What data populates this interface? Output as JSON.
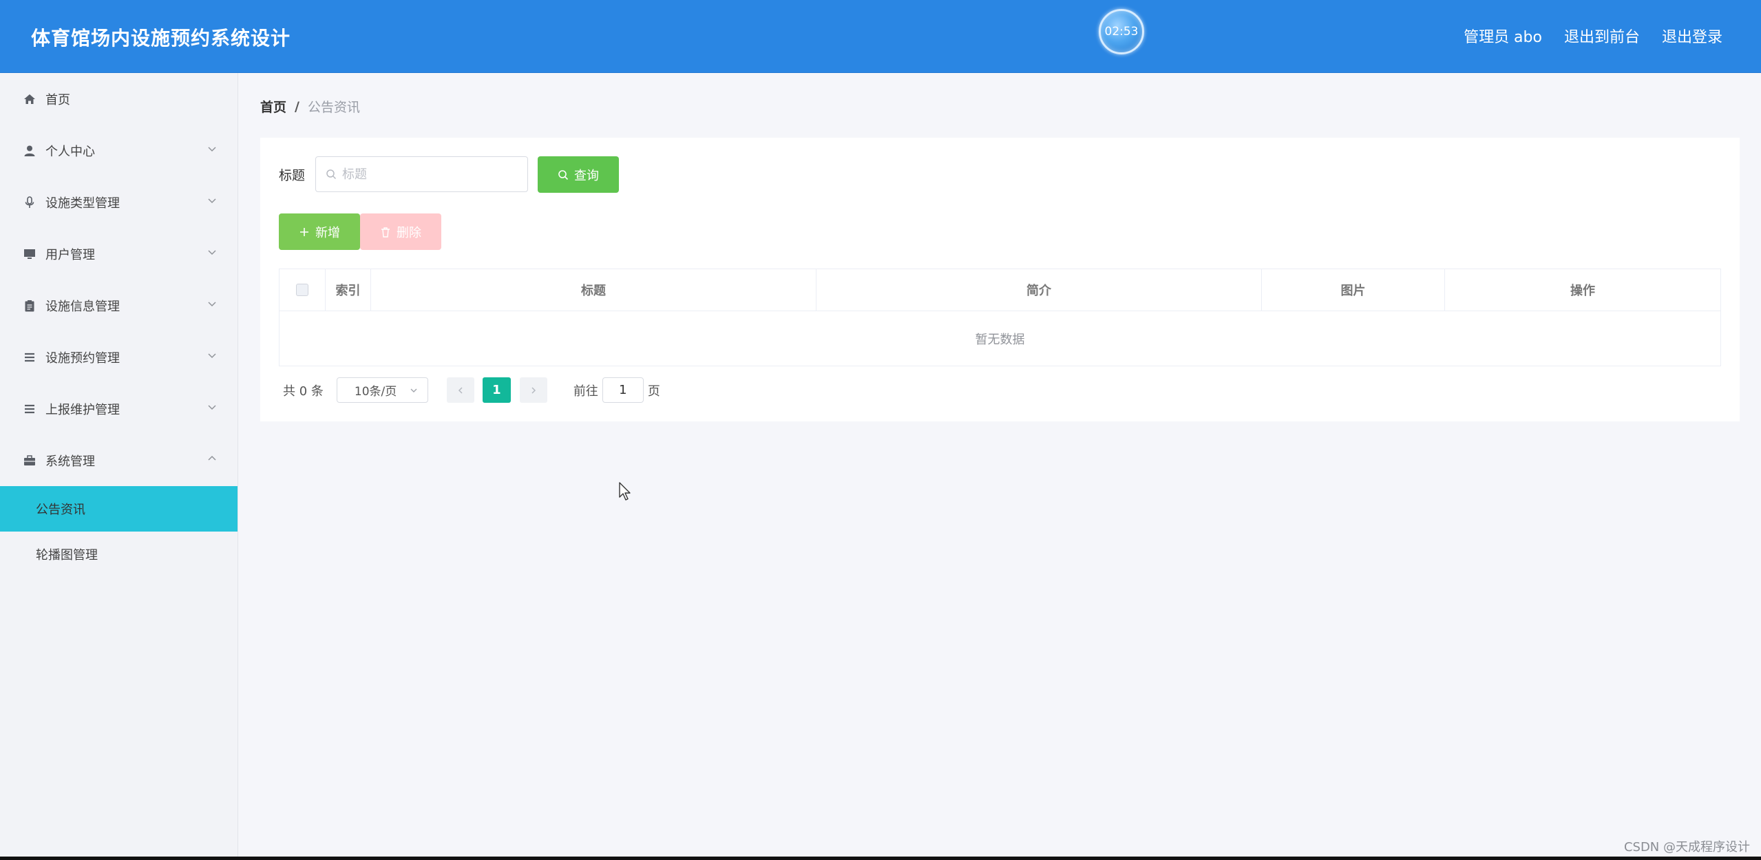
{
  "header": {
    "title": "体育馆场内设施预约系统设计",
    "clock": "02:53",
    "user": "管理员 abo",
    "to_frontend": "退出到前台",
    "logout": "退出登录"
  },
  "sidebar": {
    "items": [
      {
        "label": "首页",
        "icon": "home-icon"
      },
      {
        "label": "个人中心",
        "icon": "user-icon"
      },
      {
        "label": "设施类型管理",
        "icon": "microphone-icon"
      },
      {
        "label": "用户管理",
        "icon": "monitor-icon"
      },
      {
        "label": "设施信息管理",
        "icon": "clipboard-icon"
      },
      {
        "label": "设施预约管理",
        "icon": "list-icon"
      },
      {
        "label": "上报维护管理",
        "icon": "list-icon"
      },
      {
        "label": "系统管理",
        "icon": "briefcase-icon"
      }
    ],
    "subitems": [
      {
        "label": "公告资讯",
        "active": true
      },
      {
        "label": "轮播图管理",
        "active": false
      }
    ]
  },
  "breadcrumb": {
    "home": "首页",
    "separator": "/",
    "current": "公告资讯"
  },
  "search": {
    "label": "标题",
    "placeholder": "标题",
    "button": "查询"
  },
  "actions": {
    "add": "新增",
    "delete": "删除"
  },
  "table": {
    "columns": [
      "索引",
      "标题",
      "简介",
      "图片",
      "操作"
    ],
    "empty_text": "暂无数据"
  },
  "pagination": {
    "total": "共 0 条",
    "page_size": "10条/页",
    "current_page": "1",
    "goto_label": "前往",
    "goto_value": "1",
    "page_suffix": "页"
  },
  "watermark": "CSDN @天成程序设计",
  "colors": {
    "header_bg": "#2a86e3",
    "active_menu": "#26c3da",
    "query_button": "#5fc44e",
    "add_button": "#7cca54",
    "delete_button": "#ffc9cc",
    "current_page": "#12b89a"
  }
}
